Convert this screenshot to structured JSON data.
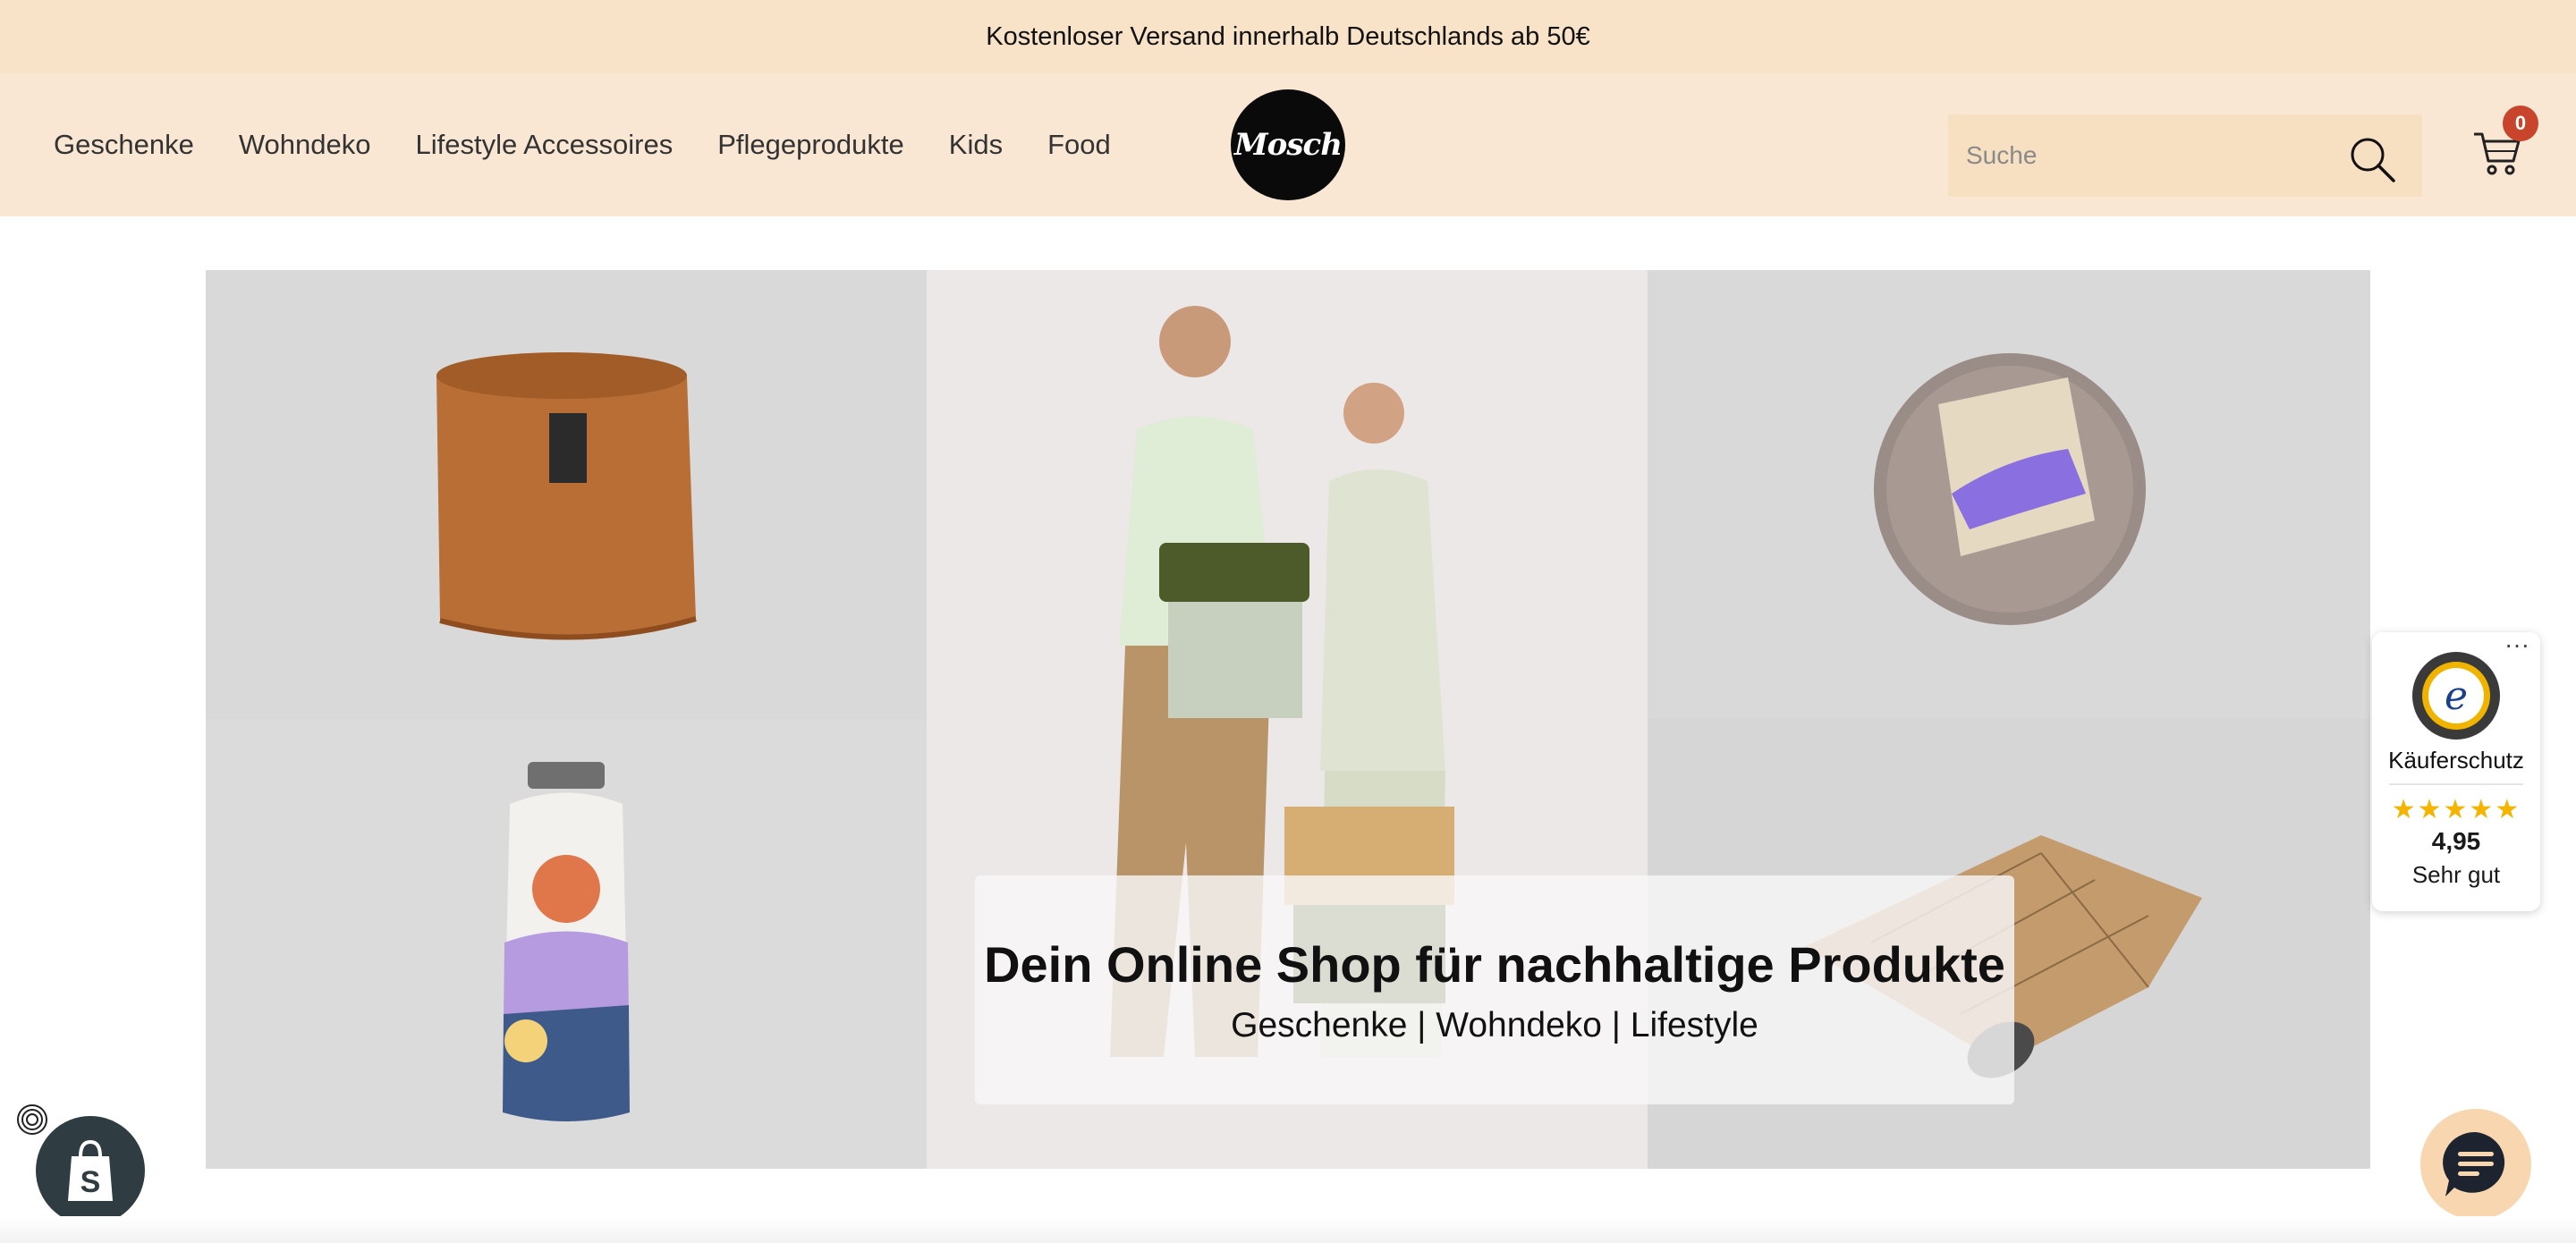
{
  "announcement": {
    "text": "Kostenloser Versand innerhalb Deutschlands ab 50€"
  },
  "header": {
    "nav": [
      {
        "label": "Geschenke"
      },
      {
        "label": "Wohndeko"
      },
      {
        "label": "Lifestyle Accessoires"
      },
      {
        "label": "Pflegeprodukte"
      },
      {
        "label": "Kids"
      },
      {
        "label": "Food"
      }
    ],
    "logo_text": "Mosch",
    "search": {
      "placeholder": "Suche",
      "value": ""
    },
    "cart": {
      "count": "0"
    }
  },
  "hero": {
    "title": "Dein Online Shop für nachhaltige Produkte",
    "subtitle": "Geschenke | Wohndeko | Lifestyle",
    "tiles": [
      {
        "subject": "felt-plant-pot"
      },
      {
        "subject": "models-with-backpacks"
      },
      {
        "subject": "soap-on-plate"
      },
      {
        "subject": "insulated-bottle"
      },
      {
        "subject": "cork-yoga-mat"
      }
    ]
  },
  "trusted_shops": {
    "label": "Käuferschutz",
    "stars": "★★★★★",
    "score": "4,95",
    "rating_text": "Sehr gut",
    "menu": "···"
  },
  "colors": {
    "announcement_bg": "#f8e2c8",
    "header_bg": "#f9e7d4",
    "search_bg": "#f7dfc2",
    "badge": "#c8452b",
    "star": "#f4b400"
  }
}
